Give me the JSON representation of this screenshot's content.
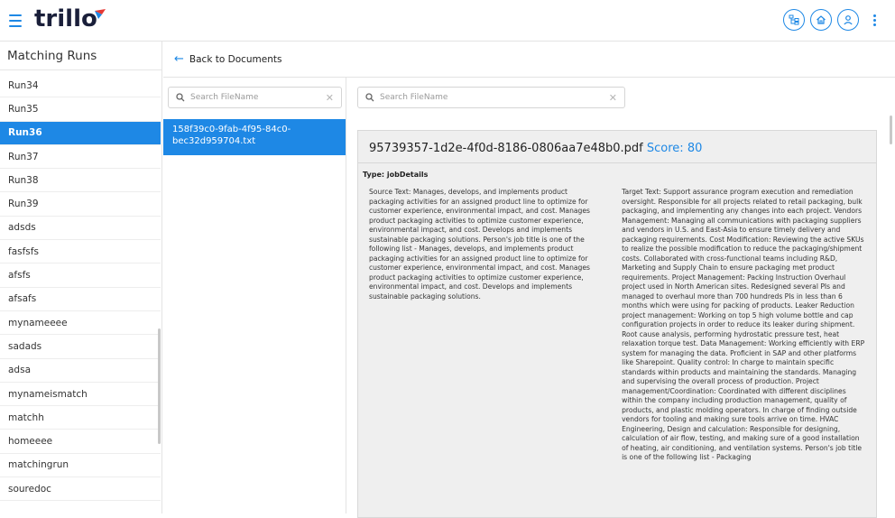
{
  "app": {
    "logo_text": "trillo"
  },
  "header_icons": [
    "hierarchy-icon",
    "home-icon",
    "user-icon",
    "more-vert-icon"
  ],
  "sidebar": {
    "title": "Matching Runs",
    "active_index": 2,
    "items": [
      {
        "label": "Run34"
      },
      {
        "label": "Run35"
      },
      {
        "label": "Run36"
      },
      {
        "label": "Run37"
      },
      {
        "label": "Run38"
      },
      {
        "label": "Run39"
      },
      {
        "label": "adsds"
      },
      {
        "label": "fasfsfs"
      },
      {
        "label": "afsfs"
      },
      {
        "label": "afsafs"
      },
      {
        "label": "mynameeee"
      },
      {
        "label": "sadads"
      },
      {
        "label": "adsa"
      },
      {
        "label": "mynameismatch"
      },
      {
        "label": "matchh"
      },
      {
        "label": "homeeee"
      },
      {
        "label": "matchingrun"
      },
      {
        "label": "souredoc"
      }
    ]
  },
  "back": {
    "label": "Back to Documents"
  },
  "file_search": {
    "placeholder": "Search FileName"
  },
  "match_search": {
    "placeholder": "Search FileName"
  },
  "files": [
    {
      "name": "158f39c0-9fab-4f95-84c0-bec32d959704.txt"
    }
  ],
  "match": {
    "filename": "95739357-1d2e-4f0d-8186-0806aa7e48b0.pdf",
    "score_label": "Score: 80",
    "type_label": "Type: jobDetails",
    "source_text": "Source Text: Manages, develops, and implements product packaging activities for an assigned product line to optimize for customer experience, environmental impact, and cost. Manages product packaging activities to optimize customer experience, environmental impact, and cost. Develops and implements sustainable packaging solutions. Person's job title is one of the following list - Manages, develops, and implements product packaging activities for an assigned product line to optimize for customer experience, environmental impact, and cost. Manages product packaging activities to optimize customer experience, environmental impact, and cost. Develops and implements sustainable packaging solutions.",
    "target_text": "Target Text: Support assurance program execution and remediation oversight. Responsible for all projects related to retail packaging, bulk packaging, and implementing any changes into each project. Vendors Management: Managing all communications with packaging suppliers and vendors in U.S. and East-Asia to ensure timely delivery and packaging requirements. Cost Modification: Reviewing the active SKUs to realize the possible modification to reduce the packaging/shipment costs. Collaborated with cross-functional teams including R&D, Marketing and Supply Chain to ensure packaging met product requirements. Project Management: Packing Instruction Overhaul project used in North American sites. Redesigned several PIs and managed to overhaul more than 700 hundreds PIs in less than 6 months which were using for packing of products. Leaker Reduction project management: Working on top 5 high volume bottle and cap configuration projects in order to reduce its leaker during shipment. Root cause analysis, performing hydrostatic pressure test, heat relaxation torque test. Data Management: Working efficiently with ERP system for managing the data. Proficient in SAP and other platforms like Sharepoint. Quality control: In charge to maintain specific standards within products and maintaining the standards. Managing and supervising the overall process of production. Project management/Coordination: Coordinated with different disciplines within the company including production management, quality of products, and plastic molding operators. In charge of finding outside vendors for tooling and making sure tools arrive on time. HVAC Engineering, Design and calculation: Responsible for designing, calculation of air flow, testing, and making sure of a good installation of heating, air conditioning, and ventilation systems. Person's job title is one of the following list - Packaging"
  },
  "colors": {
    "accent": "#1e88e5",
    "logo": "#1a1f3a"
  }
}
